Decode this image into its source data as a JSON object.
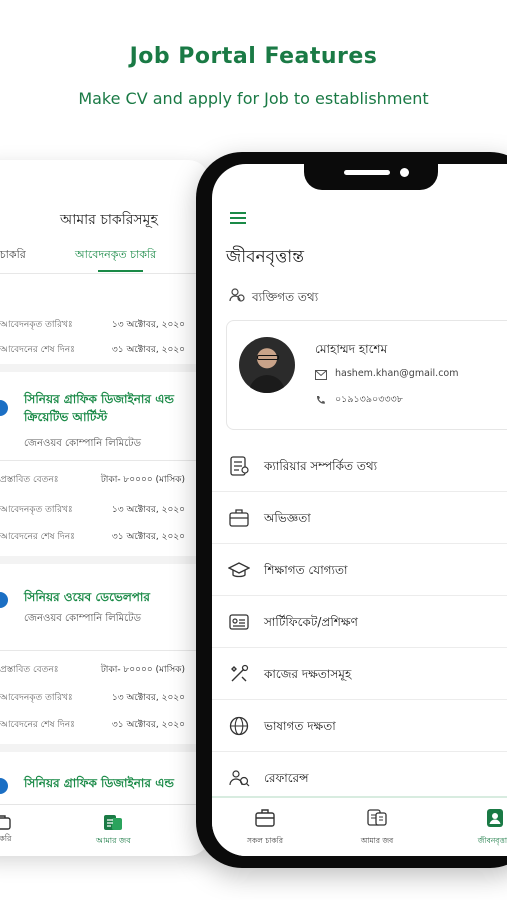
{
  "hero": {
    "title": "Job Portal Features",
    "subtitle": "Make CV and apply for Job to establishment"
  },
  "back_screen": {
    "header": "আমার চাকরিসমূহ",
    "tabs": [
      {
        "label": "ত চাকরি"
      },
      {
        "label": "আবেদনকৃত চাকরি"
      }
    ],
    "top_rows": [
      {
        "key": "আবেদনকৃত তারিখঃ",
        "value": "১৩ অক্টোবর, ২০২০"
      },
      {
        "key": "আবেদনের শেষ দিনঃ",
        "value": "৩১ অক্টোবর, ২০২০"
      }
    ],
    "jobs": [
      {
        "title_line1": "সিনিয়র গ্রাফিক ডিজাইনার এন্ড",
        "title_line2": "ক্রিয়েটিভ আর্টিস্ট",
        "company": "জেনওয়ব কোম্পানি লিমিটেড",
        "rows": [
          {
            "key": "প্রস্তাবিত বেতনঃ",
            "value": "টাকা- ৮০০০০ (মাসিক)"
          },
          {
            "key": "আবেদনকৃত তারিখঃ",
            "value": "১৩ অক্টোবর, ২০২০"
          },
          {
            "key": "আবেদনের শেষ দিনঃ",
            "value": "৩১ অক্টোবর, ২০২০"
          }
        ]
      },
      {
        "title_line1": "সিনিয়র ওয়েব ডেভেলপার",
        "title_line2": "",
        "company": "জেনওয়ব কোম্পানি লিমিটেড",
        "rows": [
          {
            "key": "প্রস্তাবিত বেতনঃ",
            "value": "টাকা- ৮০০০০ (মাসিক)"
          },
          {
            "key": "আবেদনকৃত তারিখঃ",
            "value": "১৩ অক্টোবর, ২০২০"
          },
          {
            "key": "আবেদনের শেষ দিনঃ",
            "value": "৩১ অক্টোবর, ২০২০"
          }
        ]
      },
      {
        "title_line1": "সিনিয়র গ্রাফিক ডিজাইনার এন্ড",
        "title_line2": "",
        "company": "",
        "rows": []
      }
    ],
    "nav": [
      {
        "label": "চাকরি",
        "icon": "briefcase-icon"
      },
      {
        "label": "আমার জব",
        "icon": "my-jobs-icon"
      }
    ]
  },
  "front_screen": {
    "title": "জীবনবৃত্তান্ত",
    "section_title": "ব্যক্তিগত তথ্য",
    "profile": {
      "name": "মোহাম্মদ হাশেম",
      "email": "hashem.khan@gmail.com",
      "phone": "০১৯১৩৯০৩৩৩৮"
    },
    "menu": [
      {
        "label": "ক্যারিয়ার সম্পর্কিত তথ্য",
        "icon": "career-info-icon"
      },
      {
        "label": "অভিজ্ঞতা",
        "icon": "briefcase-icon"
      },
      {
        "label": "শিক্ষাগত যোগ্যতা",
        "icon": "graduation-cap-icon"
      },
      {
        "label": "সার্টিফিকেট/প্রশিক্ষণ",
        "icon": "certificate-icon"
      },
      {
        "label": "কাজের দক্ষতাসমূহ",
        "icon": "tools-icon"
      },
      {
        "label": "ভাষাগত দক্ষতা",
        "icon": "globe-icon"
      },
      {
        "label": "রেফারেন্স",
        "icon": "reference-icon"
      }
    ],
    "nav": [
      {
        "label": "সকল চাকরি",
        "icon": "briefcase-icon"
      },
      {
        "label": "আমার জব",
        "icon": "my-jobs-icon"
      },
      {
        "label": "জীবনবৃত্তান্ত",
        "icon": "profile-icon",
        "active": true
      }
    ]
  },
  "colors": {
    "brand_green": "#1a7a45",
    "accent_green": "#1a8a47",
    "phone_frame": "#0b0b0b"
  }
}
